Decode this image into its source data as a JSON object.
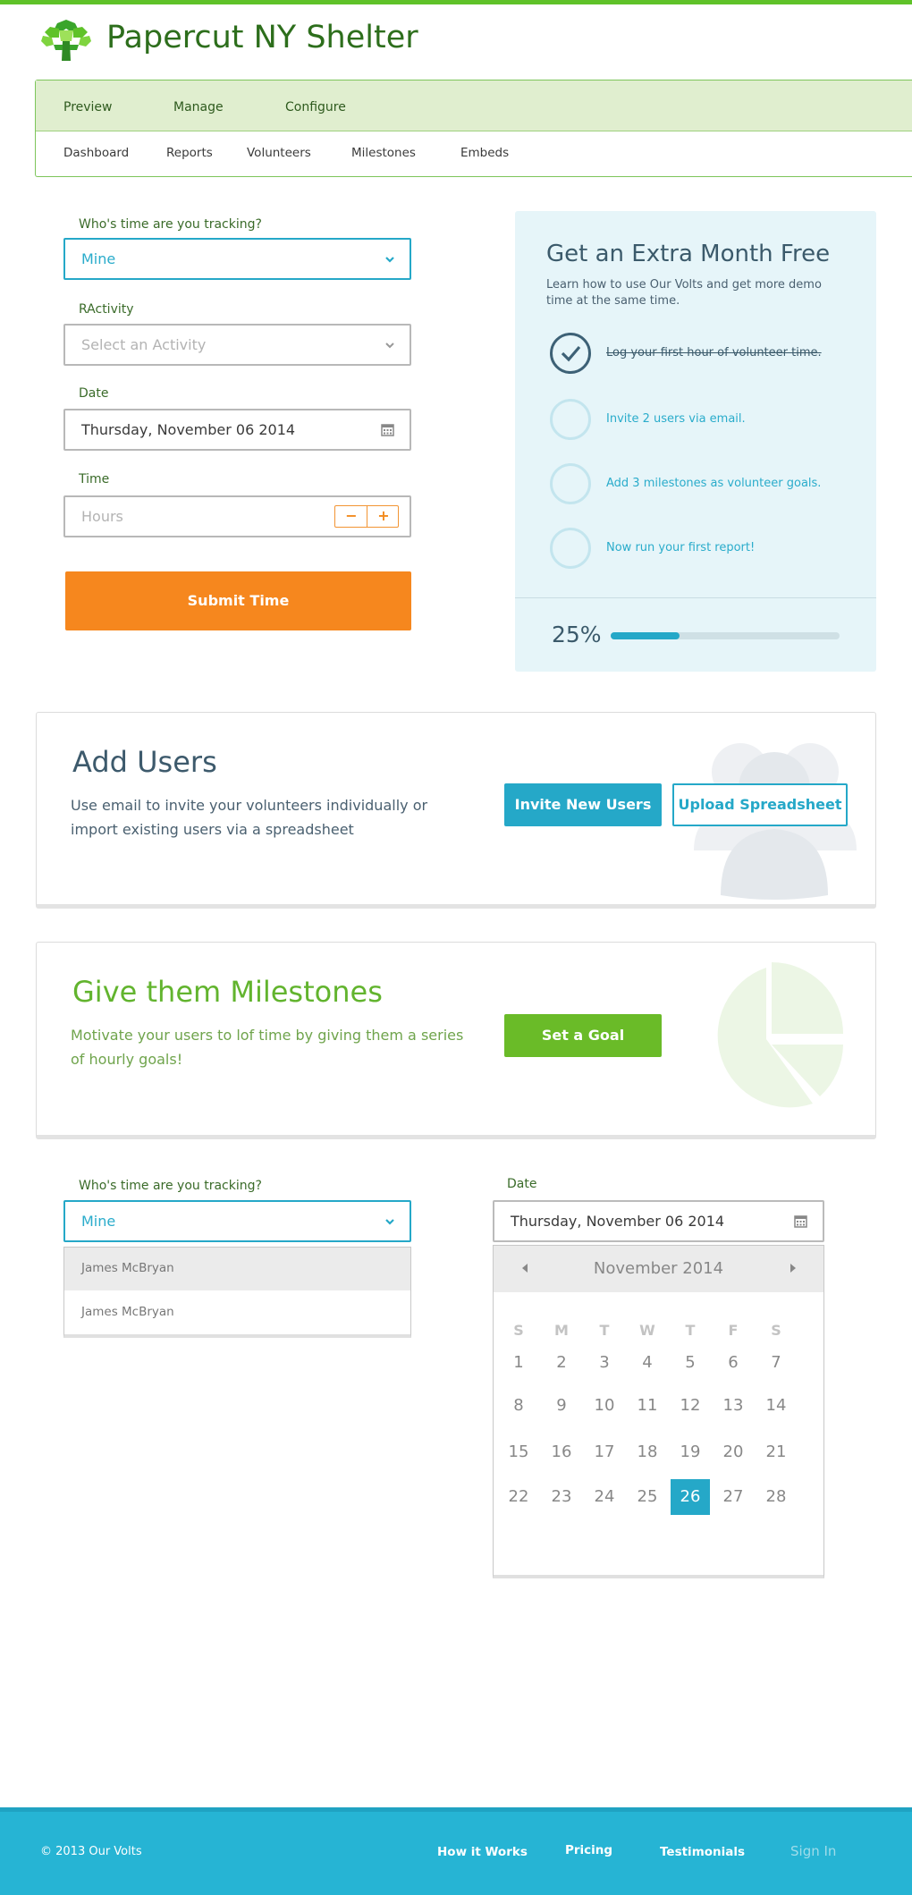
{
  "app": {
    "title": "Papercut NY Shelter"
  },
  "nav": {
    "primary": [
      "Preview",
      "Manage",
      "Configure"
    ],
    "secondary": [
      "Dashboard",
      "Reports",
      "Volunteers",
      "Milestones",
      "Embeds"
    ]
  },
  "form": {
    "tracking_label": "Who's time are you tracking?",
    "tracking_value": "Mine",
    "activity_label": "RActivity",
    "activity_placeholder": "Select an Activity",
    "date_label": "Date",
    "date_value": "Thursday, November 06 2014",
    "time_label": "Time",
    "time_placeholder": "Hours",
    "stepper_minus": "−",
    "stepper_plus": "+",
    "submit_label": "Submit Time"
  },
  "promo": {
    "title": "Get an Extra Month Free",
    "description": "Learn how to use Our Volts and get more demo time at the same time.",
    "tasks": [
      {
        "label": "Log your first hour of volunteer time.",
        "done": true
      },
      {
        "label": "Invite 2 users via email.",
        "done": false
      },
      {
        "label": "Add 3 milestones as volunteer goals.",
        "done": false
      },
      {
        "label": "Now run your first report!",
        "done": false
      }
    ],
    "progress_label": "25%",
    "progress_fraction": 0.3
  },
  "add_users": {
    "title": "Add Users",
    "description": "Use email to invite your volunteers individually or import existing users via a spreadsheet",
    "invite_label": "Invite New Users",
    "upload_label": "Upload Spreadsheet"
  },
  "milestones": {
    "title": "Give them Milestones",
    "description": "Motivate your users to lof time by giving them a series of hourly goals!",
    "goal_label": "Set a Goal"
  },
  "dropdown_demo": {
    "label": "Who's time are you tracking?",
    "value": "Mine",
    "options": [
      "James McBryan",
      "James McBryan"
    ]
  },
  "datepicker_demo": {
    "label": "Date",
    "value": "Thursday, November 06 2014",
    "month": "November 2014",
    "weekdays": [
      "S",
      "M",
      "T",
      "W",
      "T",
      "F",
      "S"
    ],
    "weeks": [
      [
        "1",
        "2",
        "3",
        "4",
        "5",
        "6",
        "7"
      ],
      [
        "8",
        "9",
        "10",
        "11",
        "12",
        "13",
        "14"
      ],
      [
        "15",
        "16",
        "17",
        "18",
        "19",
        "20",
        "21"
      ],
      [
        "22",
        "23",
        "24",
        "25",
        "26",
        "27",
        "28"
      ]
    ],
    "selected": "26"
  },
  "footer": {
    "copyright": "© 2013 Our Volts",
    "links": [
      "How it Works",
      "Pricing",
      "Testimonials"
    ],
    "signin": "Sign In"
  },
  "colors": {
    "brand_green": "#5fc229",
    "accent_teal": "#25a8c8",
    "submit_orange": "#f6871e",
    "goal_green": "#6abb28"
  }
}
